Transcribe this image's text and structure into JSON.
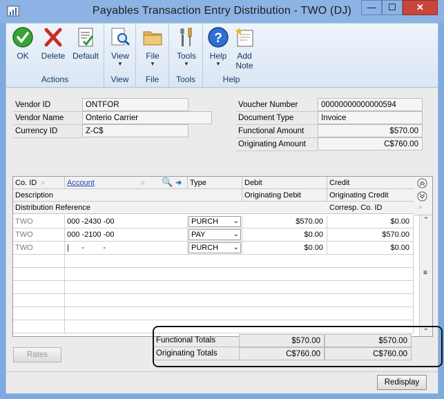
{
  "window": {
    "title": "Payables Transaction Entry Distribution  -  TWO (DJ)",
    "min_glyph": "—",
    "max_glyph": "☐",
    "close_glyph": "✕"
  },
  "ribbon": {
    "groups": [
      {
        "label": "Actions",
        "buttons": [
          {
            "label": "OK",
            "icon": "check-icon"
          },
          {
            "label": "Delete",
            "icon": "delete-x-icon"
          },
          {
            "label": "Default",
            "icon": "document-check-icon"
          }
        ]
      },
      {
        "label": "View",
        "buttons": [
          {
            "label": "View",
            "icon": "magnify-document-icon"
          }
        ]
      },
      {
        "label": "File",
        "buttons": [
          {
            "label": "File",
            "icon": "folder-icon"
          }
        ]
      },
      {
        "label": "Tools",
        "buttons": [
          {
            "label": "Tools",
            "icon": "tools-icon"
          }
        ]
      },
      {
        "label": "Help",
        "buttons": [
          {
            "label": "Help",
            "icon": "help-icon"
          },
          {
            "label": "Add\nNote",
            "icon": "note-icon"
          }
        ]
      }
    ]
  },
  "header_left": {
    "vendor_id_label": "Vendor ID",
    "vendor_id": "ONTFOR",
    "vendor_name_label": "Vendor Name",
    "vendor_name": "Onterio Carrier",
    "currency_id_label": "Currency ID",
    "currency_id": "Z-C$"
  },
  "header_right": {
    "voucher_number_label": "Voucher Number",
    "voucher_number": "00000000000000594",
    "document_type_label": "Document Type",
    "document_type": "Invoice",
    "functional_amount_label": "Functional Amount",
    "functional_amount": "$570.00",
    "originating_amount_label": "Originating Amount",
    "originating_amount": "C$760.00"
  },
  "grid": {
    "headers": {
      "co_id": "Co. ID",
      "account": "Account",
      "type": "Type",
      "debit": "Debit",
      "credit": "Credit",
      "description": "Description",
      "orig_debit": "Originating Debit",
      "orig_credit": "Originating Credit",
      "dist_ref": "Distribution Reference",
      "corresp_co": "Corresp. Co. ID"
    },
    "rows": [
      {
        "co": "TWO",
        "account": "000 -2430 -00",
        "type": "PURCH",
        "debit": "$570.00",
        "credit": "$0.00"
      },
      {
        "co": "TWO",
        "account": "000 -2100 -00",
        "type": "PAY",
        "debit": "$0.00",
        "credit": "$570.00"
      },
      {
        "co": "TWO",
        "account": "|      -         -",
        "type": "PURCH",
        "debit": "$0.00",
        "credit": "$0.00"
      }
    ]
  },
  "totals": {
    "functional_label": "Functional Totals",
    "functional_debit": "$570.00",
    "functional_credit": "$570.00",
    "originating_label": "Originating Totals",
    "originating_debit": "C$760.00",
    "originating_credit": "C$760.00"
  },
  "buttons": {
    "rates": "Rates",
    "redisplay": "Redisplay"
  }
}
